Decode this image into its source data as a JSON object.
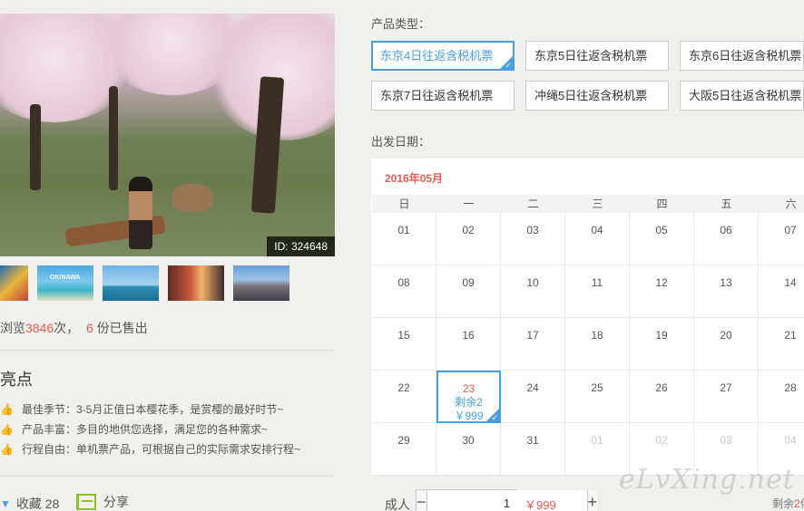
{
  "gallery": {
    "id_badge": "ID: 324648",
    "thumb_caption": "OKINAWA"
  },
  "stats": {
    "views_prefix": "浏览",
    "views_count": "3846",
    "views_mid": "次，",
    "sold_count": "6",
    "sold_suffix": "份已售出"
  },
  "highlights": {
    "title": "亮点",
    "items": [
      "最佳季节：3-5月正值日本樱花季，是赏樱的最好时节~",
      "产品丰富：多目的地供您选择，满足您的各种需求~",
      "行程自由：单机票产品，可根据自己的实际需求安排行程~"
    ]
  },
  "actions": {
    "favorite_label": "收藏",
    "favorite_count": "28",
    "share_label": "分享"
  },
  "product_type": {
    "label": "产品类型：",
    "options": [
      "东京4日往返含税机票",
      "东京5日往返含税机票",
      "东京6日往返含税机票",
      "东京7日往返含税机票",
      "冲绳5日往返含税机票",
      "大阪5日往返含税机票"
    ],
    "selected_index": 0
  },
  "departure": {
    "label": "出发日期：",
    "month": "2016年05月",
    "weekdays": [
      "日",
      "一",
      "二",
      "三",
      "四",
      "五",
      "六"
    ],
    "days": [
      [
        "01",
        "02",
        "03",
        "04",
        "05",
        "06",
        "07"
      ],
      [
        "08",
        "09",
        "10",
        "11",
        "12",
        "13",
        "14"
      ],
      [
        "15",
        "16",
        "17",
        "18",
        "19",
        "20",
        "21"
      ],
      [
        "22",
        "23",
        "24",
        "25",
        "26",
        "27",
        "28"
      ],
      [
        "29",
        "30",
        "31",
        "01",
        "02",
        "03",
        "04"
      ]
    ],
    "selected_day": "23",
    "selected_remaining": "剩余2",
    "selected_price": "￥999"
  },
  "quantity": {
    "label": "成人",
    "minus": "−",
    "value": "1",
    "plus": "+",
    "price": "￥999",
    "remain_prefix": "剩余",
    "remain_count": "2",
    "remain_suffix": "件"
  },
  "watermark": "eLvXing.net",
  "colors": {
    "accent_blue": "#4a9ed9",
    "price_red": "#e35b50",
    "highlight_orange": "#f09a2b",
    "share_green": "#8cbd2b"
  }
}
